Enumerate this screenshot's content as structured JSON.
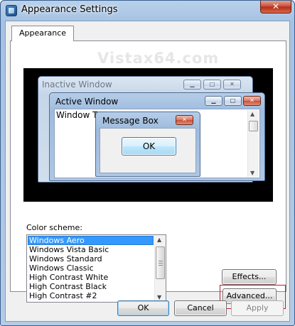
{
  "window": {
    "title": "Appearance Settings",
    "close_glyph": "✕"
  },
  "tab": {
    "label": "Appearance"
  },
  "watermark": "Vistax64.com",
  "preview": {
    "inactive_window": {
      "title": "Inactive Window"
    },
    "active_window": {
      "title": "Active Window",
      "text": "Window Text"
    },
    "message_box": {
      "title": "Message Box",
      "button": "OK"
    },
    "glyphs": {
      "minimize": "▁",
      "maximize": "□",
      "close": "✕",
      "up": "▲",
      "down": "▼"
    }
  },
  "color_scheme": {
    "label": "Color scheme:",
    "items": [
      "Windows Aero",
      "Windows Vista Basic",
      "Windows Standard",
      "Windows Classic",
      "High Contrast White",
      "High Contrast Black",
      "High Contrast #2"
    ],
    "selected": "Windows Aero"
  },
  "buttons": {
    "effects": "Effects...",
    "advanced": "Advanced...",
    "ok": "OK",
    "cancel": "Cancel",
    "apply": "Apply"
  },
  "icons": {
    "app": "display-settings-icon",
    "close": "close-icon",
    "minimize": "minimize-icon",
    "maximize": "maximize-icon",
    "scroll_up": "scroll-up-arrow-icon",
    "scroll_down": "scroll-down-arrow-icon"
  },
  "colors": {
    "selection": "#3399ff",
    "highlight_box": "#c21c2a",
    "close_button": "#c54a33",
    "title_bar": "#b9d1ea"
  }
}
